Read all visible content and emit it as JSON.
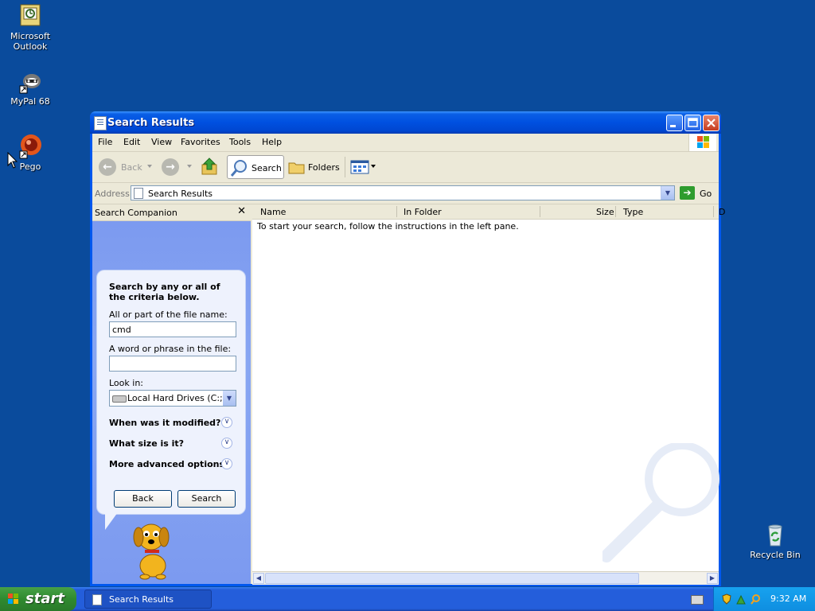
{
  "desktop": {
    "icons": [
      {
        "label": "Microsoft Outlook",
        "icon": "outlook-icon"
      },
      {
        "label": "MyPal 68",
        "icon": "mypal-icon"
      },
      {
        "label": "Pego",
        "icon": "pego-icon"
      },
      {
        "label": "Recycle Bin",
        "icon": "recycle-bin-icon"
      }
    ]
  },
  "window": {
    "title": "Search Results",
    "menu": [
      "File",
      "Edit",
      "View",
      "Favorites",
      "Tools",
      "Help"
    ],
    "toolbar": {
      "back": "Back",
      "search": "Search",
      "folders": "Folders"
    },
    "address": {
      "label": "Address",
      "value": "Search Results",
      "go": "Go"
    },
    "companion": {
      "title": "Search Companion",
      "heading": "Search by any or all of the criteria below.",
      "filename_label": "All or part of the file name:",
      "filename_value": "cmd",
      "phrase_label": "A word or phrase in the file:",
      "phrase_value": "",
      "lookin_label": "Look in:",
      "lookin_value": "Local Hard Drives (C:;E:)",
      "options": [
        "When was it modified?",
        "What size is it?",
        "More advanced options"
      ],
      "back_button": "Back",
      "search_button": "Search"
    },
    "results": {
      "columns": [
        "Name",
        "In Folder",
        "Size",
        "Type",
        "D"
      ],
      "instructions": "To start your search, follow the instructions in the left pane."
    }
  },
  "taskbar": {
    "start": "start",
    "task": "Search Results",
    "clock": "9:32 AM"
  },
  "colors": {
    "desktop": "#0a4b9c",
    "titlebar": "#0050e0",
    "start_green": "#2f8a2f",
    "taskbar": "#245edb"
  }
}
